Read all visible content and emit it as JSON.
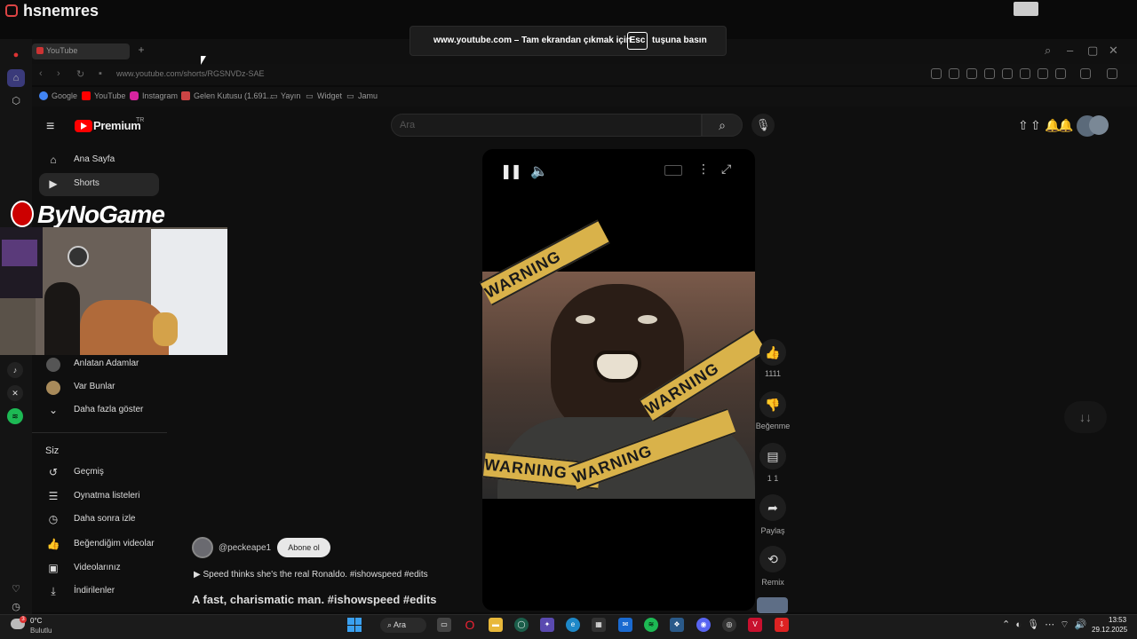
{
  "stream": {
    "title": "hsnemres",
    "overlay_brand": "ByNoGame"
  },
  "browser": {
    "tab_title": "YouTube",
    "url": "www.youtube.com/shorts/RGSNVDz-SAE",
    "bookmarks": [
      "Google",
      "YouTube",
      "Instagram",
      "Gelen Kutusu (1.691...",
      "Yayın",
      "Widget",
      "Jamu"
    ]
  },
  "fullscreen_banner": {
    "text_before": "www.youtube.com – Tam ekrandan çıkmak için",
    "key": "Esc",
    "text_after": "tuşuna basın"
  },
  "youtube": {
    "brand": "Premium",
    "tm": "TR",
    "search_placeholder": "Ara",
    "sidebar": {
      "top": [
        {
          "label": "Ana Sayfa",
          "icon": "home-icon"
        },
        {
          "label": "Shorts",
          "icon": "shorts-icon"
        }
      ],
      "subs": [
        {
          "label": "Anlatan Adamlar"
        },
        {
          "label": "Var Bunlar"
        },
        {
          "label": "Daha fazla göster"
        }
      ],
      "section_title": "Siz",
      "you_items": [
        {
          "label": "Geçmiş",
          "icon": "history-icon"
        },
        {
          "label": "Oynatma listeleri",
          "icon": "playlist-icon"
        },
        {
          "label": "Daha sonra izle",
          "icon": "watch-later-icon"
        },
        {
          "label": "Beğendiğim videolar",
          "icon": "like-icon"
        },
        {
          "label": "Videolarınız",
          "icon": "video-icon"
        },
        {
          "label": "İndirilenler",
          "icon": "download-icon"
        }
      ]
    },
    "short": {
      "actions": [
        {
          "icon": "like-icon",
          "label": "1111"
        },
        {
          "icon": "dislike-icon",
          "label": "Beğenme"
        },
        {
          "icon": "comment-icon",
          "label": "1 1"
        },
        {
          "icon": "share-icon",
          "label": "Paylaş"
        },
        {
          "icon": "remix-icon",
          "label": "Remix"
        }
      ],
      "channel": "@peckeape1",
      "subscribe": "Abone ol",
      "desc_line": "Speed thinks she's the real Ronaldo. #ishowspeed #edits",
      "title": "A fast, charismatic man. #ishowspeed #edits",
      "tape_text": "WARNING"
    }
  },
  "taskbar": {
    "weather_temp": "0°C",
    "weather_cond": "Bulutlu",
    "weather_badge": "3",
    "search": "Ara",
    "time": "13:53",
    "date": "29.12.2025"
  }
}
